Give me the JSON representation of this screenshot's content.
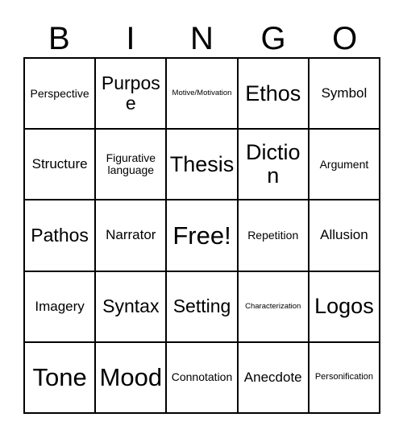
{
  "header": {
    "letters": [
      "B",
      "I",
      "N",
      "G",
      "O"
    ]
  },
  "colors": {
    "background": "#ffffff",
    "grid_line": "#000000",
    "text": "#000000"
  },
  "grid": {
    "columns": 5,
    "rows": 5,
    "free_space_label": "Free!",
    "free_space_position": {
      "row": 3,
      "column": 3
    },
    "cells": [
      [
        {
          "label": "Perspective",
          "size": "s"
        },
        {
          "label": "Purpose",
          "size": "l"
        },
        {
          "label": "Motive/Motivation",
          "size": "xxs"
        },
        {
          "label": "Ethos",
          "size": "xl"
        },
        {
          "label": "Symbol",
          "size": "m"
        }
      ],
      [
        {
          "label": "Structure",
          "size": "m"
        },
        {
          "label": "Figurative language",
          "size": "s"
        },
        {
          "label": "Thesis",
          "size": "xl"
        },
        {
          "label": "Diction",
          "size": "xl"
        },
        {
          "label": "Argument",
          "size": "s"
        }
      ],
      [
        {
          "label": "Pathos",
          "size": "l"
        },
        {
          "label": "Narrator",
          "size": "m"
        },
        {
          "label": "Free!",
          "size": "xxl"
        },
        {
          "label": "Repetition",
          "size": "s"
        },
        {
          "label": "Allusion",
          "size": "m"
        }
      ],
      [
        {
          "label": "Imagery",
          "size": "m"
        },
        {
          "label": "Syntax",
          "size": "l"
        },
        {
          "label": "Setting",
          "size": "l"
        },
        {
          "label": "Characterization",
          "size": "xxs"
        },
        {
          "label": "Logos",
          "size": "xl"
        }
      ],
      [
        {
          "label": "Tone",
          "size": "xxl"
        },
        {
          "label": "Mood",
          "size": "xxl"
        },
        {
          "label": "Connotation",
          "size": "s"
        },
        {
          "label": "Anecdote",
          "size": "m"
        },
        {
          "label": "Personification",
          "size": "xs"
        }
      ]
    ]
  }
}
